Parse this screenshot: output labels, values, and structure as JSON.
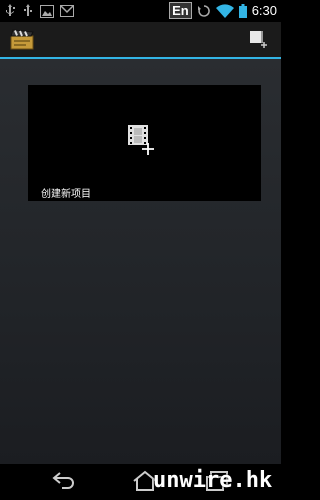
{
  "status_bar": {
    "left_icons": [
      "usb-icon",
      "usb-debug-icon",
      "image-icon",
      "gmail-icon"
    ],
    "language": "En",
    "time": "6:30",
    "right_icons": [
      "sync-icon",
      "wifi-icon",
      "battery-icon"
    ]
  },
  "action_bar": {
    "app_icon": "clapperboard-icon",
    "action_icon": "new-project-icon"
  },
  "project_card": {
    "label": "创建新项目",
    "icon": "film-add-icon"
  },
  "nav_bar": {
    "buttons": [
      "back-icon",
      "home-icon",
      "recent-apps-icon"
    ]
  },
  "watermark": "unwire.hk",
  "colors": {
    "accent": "#33b5e5",
    "background": "#212428",
    "card": "#000000"
  }
}
